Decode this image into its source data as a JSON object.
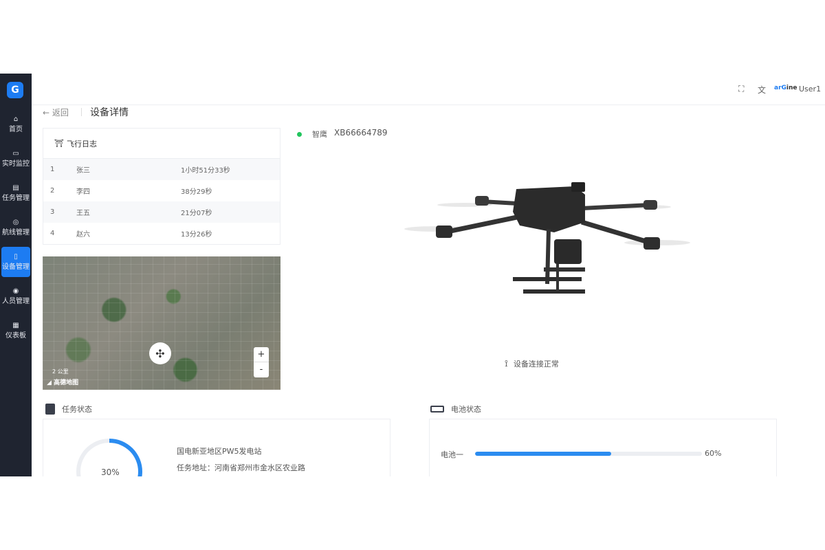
{
  "app": {
    "logo_text": "G"
  },
  "sidebar": {
    "items": [
      {
        "label": "首页",
        "icon": "home-icon"
      },
      {
        "label": "实时监控",
        "icon": "monitor-icon"
      },
      {
        "label": "任务管理",
        "icon": "task-icon"
      },
      {
        "label": "航线管理",
        "icon": "route-icon"
      },
      {
        "label": "设备管理",
        "icon": "device-icon",
        "active": true
      },
      {
        "label": "人员管理",
        "icon": "user-group-icon"
      },
      {
        "label": "仪表板",
        "icon": "dashboard-icon"
      }
    ]
  },
  "topbar": {
    "brand_a": "arG",
    "brand_b": "ine",
    "user": "User1"
  },
  "page": {
    "back": "返回",
    "title": "设备详情"
  },
  "flight_log": {
    "title": "飞行日志",
    "rows": [
      {
        "no": "1",
        "name": "张三",
        "duration": "1小时51分33秒"
      },
      {
        "no": "2",
        "name": "李四",
        "duration": "38分29秒"
      },
      {
        "no": "3",
        "name": "王五",
        "duration": "21分07秒"
      },
      {
        "no": "4",
        "name": "赵六",
        "duration": "13分26秒"
      }
    ]
  },
  "map": {
    "zoom_in": "+",
    "zoom_out": "-",
    "scale": "2 公里",
    "logo": "高德地图"
  },
  "device": {
    "name": "智鹰",
    "id": "XB66664789",
    "status_color": "#22c55e",
    "connection": "设备连接正常"
  },
  "task_status": {
    "title": "任务状态",
    "progress": 0.3,
    "progress_label": "30%",
    "task_name": "国电新亚地区PW5发电站",
    "address": "任务地址：河南省郑州市金水区农业路"
  },
  "battery_status": {
    "title": "电池状态",
    "batteries": [
      {
        "label": "电池一",
        "level": 0.6,
        "level_label": "60%"
      }
    ]
  },
  "colors": {
    "accent": "#1d7cf2",
    "sidebar_bg": "#1f2430",
    "progress": "#2b8cf0"
  }
}
